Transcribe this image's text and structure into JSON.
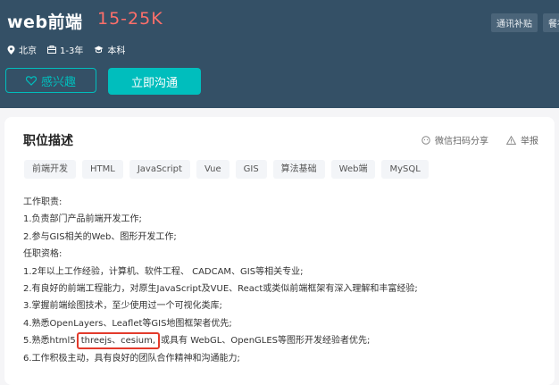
{
  "job": {
    "title": "web前端",
    "salary": "15-25K",
    "location": "北京",
    "experience": "1-3年",
    "education": "本科"
  },
  "header_tags": [
    "通讯补贴",
    "餐补"
  ],
  "actions": {
    "interest_label": "感兴趣",
    "chat_label": "立即沟通"
  },
  "card": {
    "title": "职位描述",
    "share_label": "微信扫码分享",
    "report_label": "举报"
  },
  "skills": [
    "前端开发",
    "HTML",
    "JavaScript",
    "Vue",
    "GIS",
    "算法基础",
    "Web端",
    "MySQL"
  ],
  "description": {
    "line0": "工作职责:",
    "line1": "1.负责部门产品前端开发工作;",
    "line2": "2.参与GIS相关的Web、图形开发工作;",
    "line3": "任职资格:",
    "line4": "1.2年以上工作经验，计算机、软件工程、 CADCAM、GIS等相关专业;",
    "line5": "2.有良好的前端工程能力，对原生JavaScript及VUE、React或类似前端框架有深入理解和丰富经验;",
    "line6": "3.掌握前端绘图技术，至少使用过一个可视化类库;",
    "line7": "4.熟悉OpenLayers、Leaflet等GIS地图框架者优先;",
    "line8_prefix": "5.熟悉html5",
    "line8_highlight": "threejs、cesium,",
    "line8_suffix": "或具有 WebGL、OpenGLES等图形开发经验者优先;",
    "line9": "6.工作积极主动，具有良好的团队合作精神和沟通能力;"
  },
  "colors": {
    "header_bg": "#345066",
    "salary": "#fe6f6a",
    "accent": "#00bebd",
    "highlight_box": "#e33b2c"
  }
}
